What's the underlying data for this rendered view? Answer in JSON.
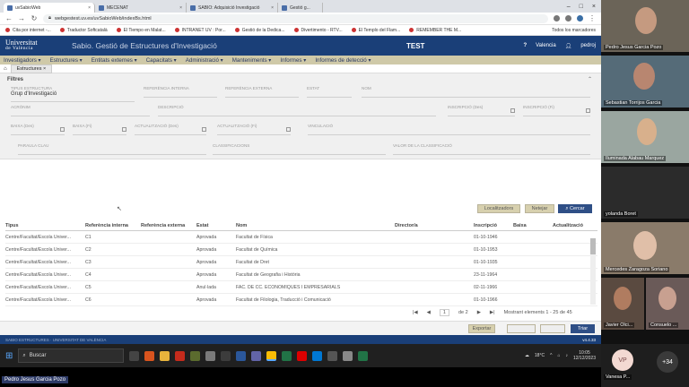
{
  "browser": {
    "tabs": [
      {
        "label": "uvSabioWeb",
        "active": true
      },
      {
        "label": "MECENAT",
        "active": false
      },
      {
        "label": "SABIO: Adquisició Investigació",
        "active": false
      },
      {
        "label": "Gestió g...",
        "active": false
      }
    ],
    "url": "webgestest.uv.es/uvSabioWeb/indexBs.html",
    "bookmarks": [
      "Cita por internet -...",
      "Traductor Softcatalà",
      "El Tiempo en Malat...",
      "INTRANET UV : Por...",
      "Gestió de la Dedica...",
      "Divertimento - RTV...",
      "El Templo del Flam...",
      "REMEMBER THE M..."
    ],
    "bookmarks_folder": "Todos los marcadores"
  },
  "app": {
    "logo_line1": "Universitat",
    "logo_line2": "de València",
    "title": "Sabio. Gestió de Estructures d'Investigació",
    "env": "TEST",
    "help": "?",
    "location": "Valencia",
    "user": "pedroj",
    "accent": "#1a3f78",
    "menu_bg": "#cfc9a8"
  },
  "menu": [
    "Investigadors ▾",
    "Estructures ▾",
    "Entitats externes ▾",
    "Capacitats ▾",
    "Administració ▾",
    "Manteniments ▾",
    "Informes ▾",
    "Informes de detecció ▾"
  ],
  "breadcrumb": {
    "home_icon": "home-icon",
    "tab": "Estructures"
  },
  "filters": {
    "title": "Filtres",
    "tipus_label": "TIPUS ESTRUCTURA",
    "tipus_value": "Grup d'Investigació",
    "ref_interna": "REFERÈNCIA INTERNA",
    "ref_externa": "REFERÈNCIA EXTERNA",
    "estat": "ESTAT",
    "nom": "NOM",
    "acronim": "ACRÒNIM",
    "descripcio": "DESCRIPCIÓ",
    "inscripcio_des": "INSCRIPCIÓ (Des)",
    "inscripcio_fins": "INSCRIPCIÓ (Fi)",
    "baixa_des": "BAIXA (Des)",
    "baixa_fins": "BAIXA (Fi)",
    "actualitzacio_des": "ACTUALITZACIÓ (Des)",
    "actualitzacio_fins": "ACTUALITZACIÓ (Fi)",
    "vinculacio": "VINCULACIÓ",
    "paraula_clau": "PARAULA CLAU",
    "classificacions": "CLASSIFICACIONS",
    "valor_classificacio": "VALOR DE LA CLASSIFICACIÓ",
    "btn_localitzadors": "Localitzadors",
    "btn_netejar": "Netejar",
    "btn_cercar": "Cercar"
  },
  "table": {
    "headers": [
      "Tipus",
      "Referència interna",
      "Referència externa",
      "Estat",
      "Nom",
      "Director/a",
      "Inscripció",
      "Baixa",
      "Actualització"
    ],
    "rows": [
      [
        "Centre/Facultat/Escola Univer...",
        "C1",
        "",
        "Aprovada",
        "Facultat de Física",
        "",
        "01-10-1946",
        "",
        ""
      ],
      [
        "Centre/Facultat/Escola Univer...",
        "C2",
        "",
        "Aprovada",
        "Facultat de Química",
        "",
        "01-10-1953",
        "",
        ""
      ],
      [
        "Centre/Facultat/Escola Univer...",
        "C3",
        "",
        "Aprovada",
        "Facultat de Dret",
        "",
        "01-10-1935",
        "",
        ""
      ],
      [
        "Centre/Facultat/Escola Univer...",
        "C4",
        "",
        "Aprovada",
        "Facultat de Geografia i Història",
        "",
        "23-11-1964",
        "",
        ""
      ],
      [
        "Centre/Facultat/Escola Univer...",
        "C5",
        "",
        "Anul·lada",
        "FAC. DE CC. ECONÒMIQUES I EMPRESARIALS",
        "",
        "02-11-1966",
        "",
        ""
      ],
      [
        "Centre/Facultat/Escola Univer...",
        "C6",
        "",
        "Aprovada",
        "Facultat de Filologia, Traducció i Comunicació",
        "",
        "01-10-1966",
        "",
        ""
      ]
    ]
  },
  "pager": {
    "current": "1",
    "of": "de 2",
    "summary": "Mostrant elements 1 - 25 de 45"
  },
  "footer": {
    "exportar": "Exportar",
    "triar": "Triar",
    "version": "v4.4.33",
    "left_text": "SABIO ESTRUCTURES · UNIVERSITAT DE VALÈNCIA"
  },
  "taskbar": {
    "search": "Buscar",
    "weather": "18°C",
    "time": "10:05",
    "date": "12/12/2023"
  },
  "participants": [
    {
      "name": "Pedro Jesus Garcia Pozo"
    },
    {
      "name": "Sebastian Torrijos Garcia"
    },
    {
      "name": "Iluminada Alabau Marquez"
    },
    {
      "name": "yolanda Boret"
    },
    {
      "name": "Mercedes Zaragoza Soriano"
    },
    {
      "name": "Javier Olci..."
    },
    {
      "name": "Consuelo ..."
    },
    {
      "name": "Vanesa P..."
    }
  ],
  "participants_more": "+34",
  "participant_initials": "VP",
  "presenter_badge": "Pedro Jesus Garcia Pozo"
}
